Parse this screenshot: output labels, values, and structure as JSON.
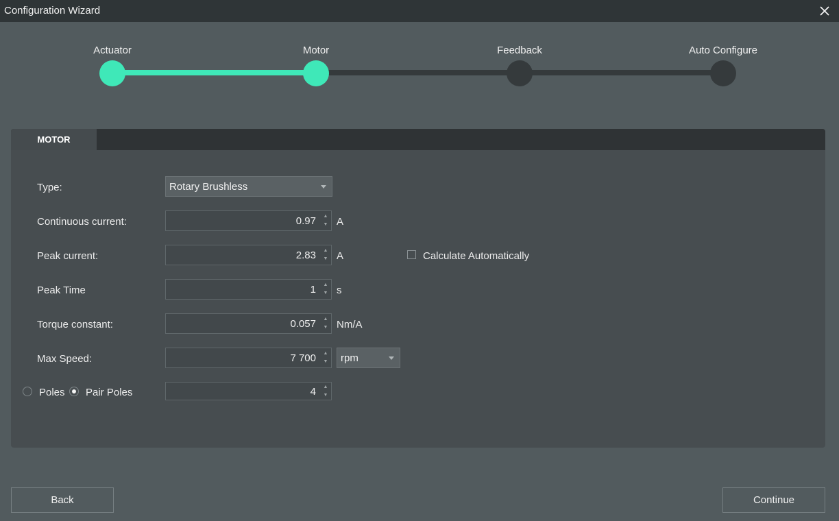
{
  "window": {
    "title": "Configuration Wizard"
  },
  "steps": [
    {
      "label": "Actuator",
      "done": true
    },
    {
      "label": "Motor",
      "done": true
    },
    {
      "label": "Feedback",
      "done": false
    },
    {
      "label": "Auto Configure",
      "done": false
    }
  ],
  "panel": {
    "tab": "MOTOR",
    "type": {
      "label": "Type:",
      "value": "Rotary Brushless"
    },
    "continuous_current": {
      "label": "Continuous current:",
      "value": "0.97",
      "unit": "A"
    },
    "peak_current": {
      "label": "Peak current:",
      "value": "2.83",
      "unit": "A"
    },
    "calculate_automatically": {
      "label": "Calculate Automatically",
      "checked": false
    },
    "peak_time": {
      "label": "Peak Time",
      "value": "1",
      "unit": "s"
    },
    "torque_constant": {
      "label": "Torque constant:",
      "value": "0.057",
      "unit": "Nm/A"
    },
    "max_speed": {
      "label": "Max Speed:",
      "value": "7 700",
      "unit": "rpm"
    },
    "poles": {
      "poles_label": "Poles",
      "pair_poles_label": "Pair Poles",
      "selected": "pair_poles",
      "value": "4"
    }
  },
  "footer": {
    "back_label": "Back",
    "continue_label": "Continue"
  },
  "colors": {
    "accent": "#3fe8b8",
    "inactive": "#353a3c",
    "background": "#525b5e",
    "panel": "#474d50"
  }
}
